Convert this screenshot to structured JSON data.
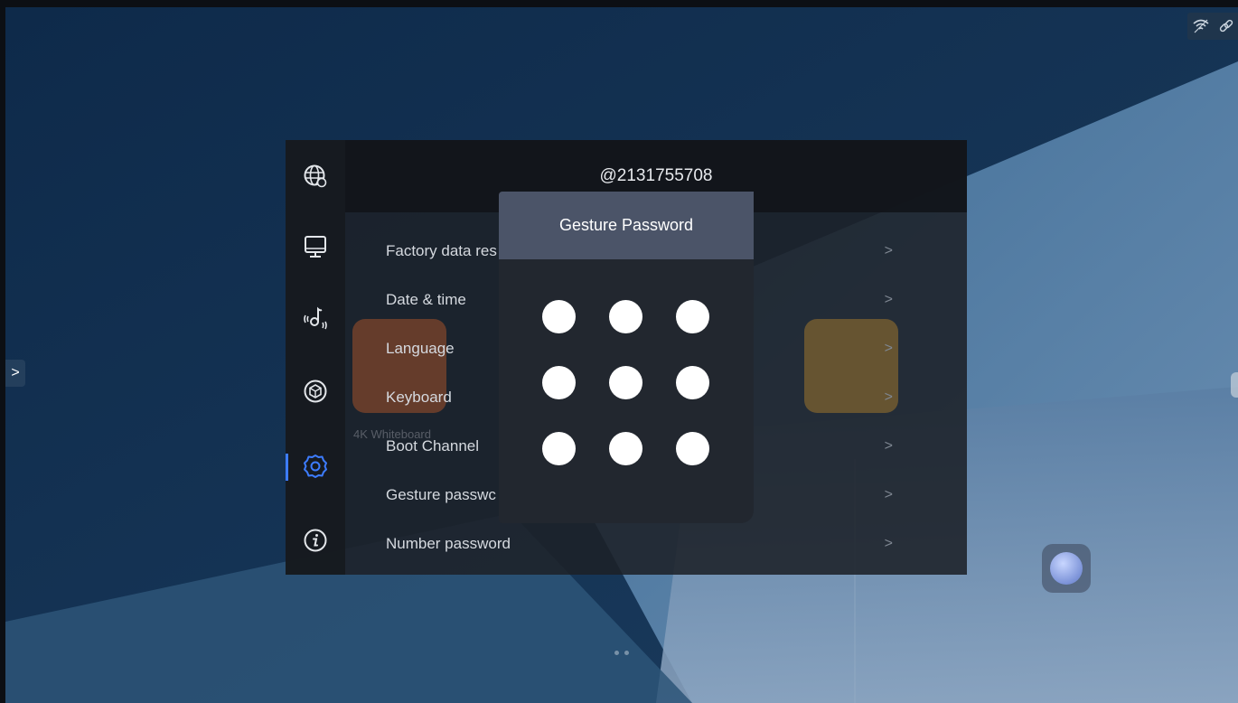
{
  "status_bar": {
    "icons": [
      "wifi-icon",
      "link-icon"
    ]
  },
  "settings": {
    "header_title": "@2131755708",
    "sidebar": [
      {
        "icon": "globe-settings-icon",
        "active": false
      },
      {
        "icon": "monitor-icon",
        "active": false
      },
      {
        "icon": "audio-icon",
        "active": false
      },
      {
        "icon": "cube-icon",
        "active": false
      },
      {
        "icon": "settings-gear-icon",
        "active": true
      },
      {
        "icon": "info-icon",
        "active": false
      }
    ],
    "menu_items": [
      {
        "label": "Factory data res"
      },
      {
        "label": "Date & time"
      },
      {
        "label": "Language"
      },
      {
        "label": "Keyboard"
      },
      {
        "label": "Boot Channel"
      },
      {
        "label": "Gesture passwc"
      },
      {
        "label": "Number password"
      }
    ],
    "chevron": ">"
  },
  "background_apps": {
    "whiteboard_label": "4K Whiteboard"
  },
  "dialog": {
    "title": "Gesture Password",
    "dot_count": 9
  },
  "colors": {
    "accent": "#3d7cff",
    "dialog_title_bg": "#4b5468",
    "dialog_bg": "#22272f",
    "dot": "#ffffff"
  },
  "side_arrow": ">"
}
